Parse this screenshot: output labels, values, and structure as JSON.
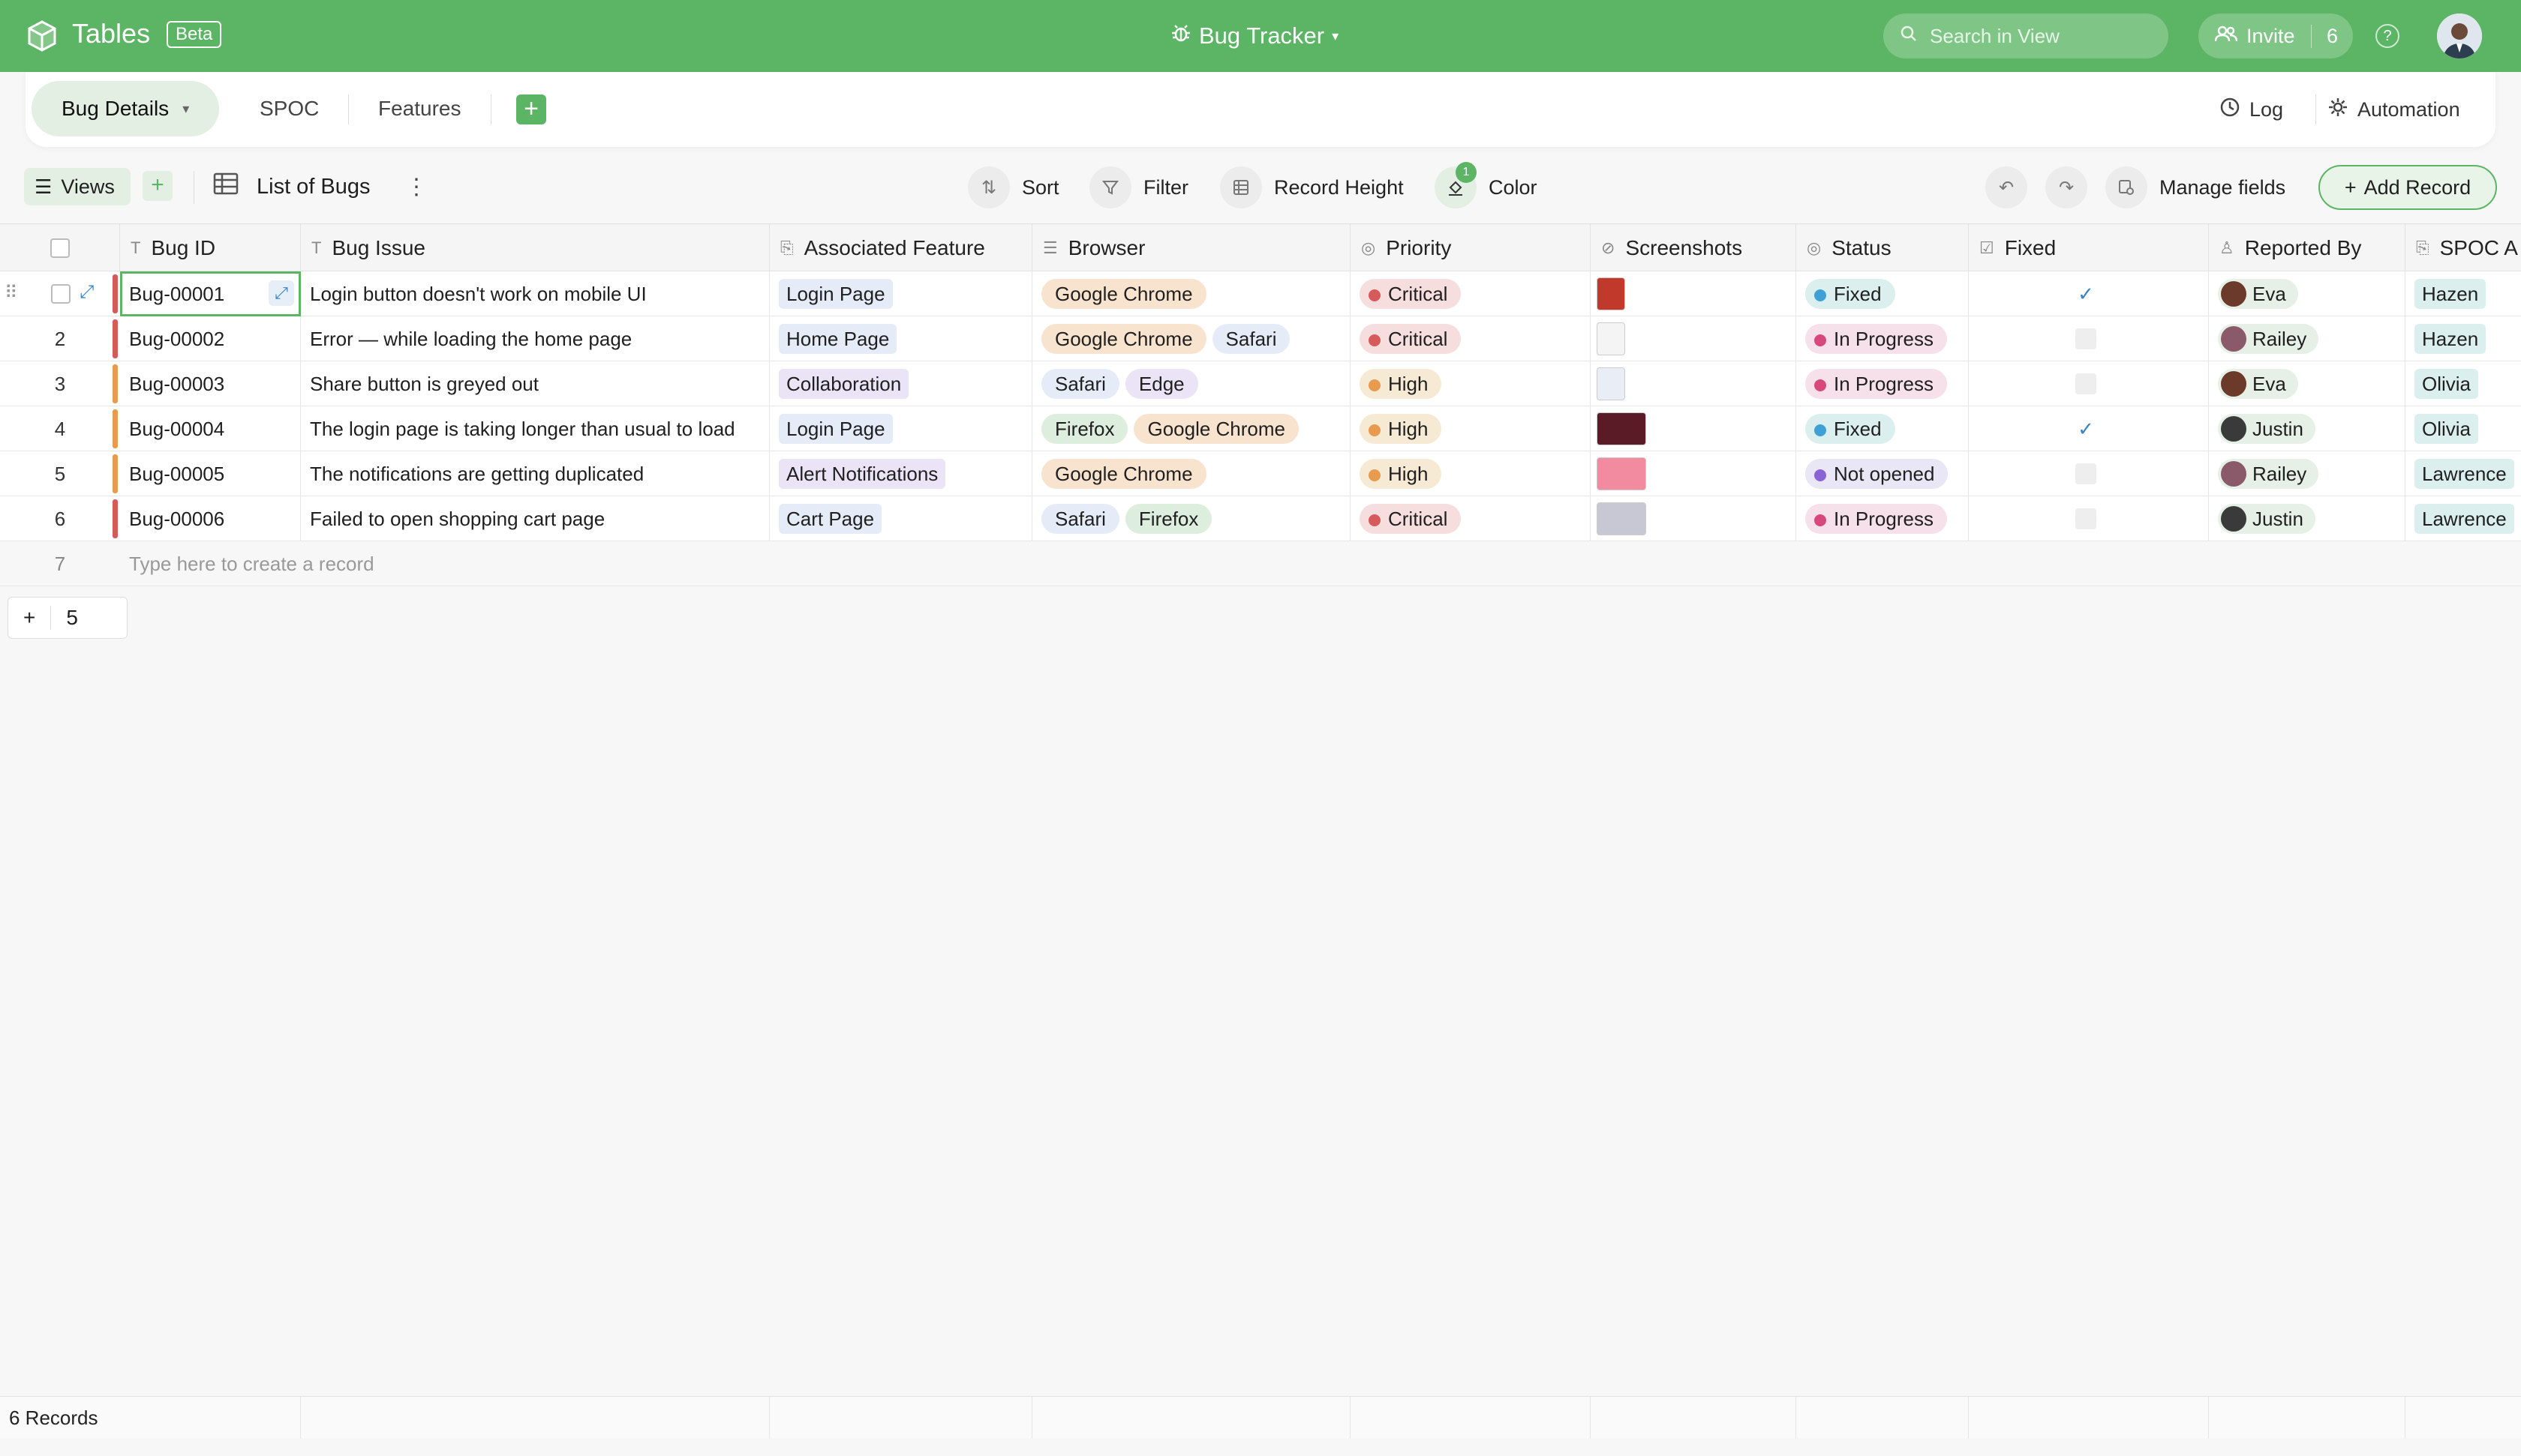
{
  "app": {
    "name": "Tables",
    "badge": "Beta",
    "base_title": "Bug Tracker"
  },
  "search": {
    "placeholder": "Search in View"
  },
  "invite": {
    "label": "Invite",
    "count": "6"
  },
  "tabs": [
    {
      "label": "Bug Details",
      "active": true
    },
    {
      "label": "SPOC"
    },
    {
      "label": "Features"
    }
  ],
  "tabbar_right": {
    "log": "Log",
    "automation": "Automation"
  },
  "toolbar": {
    "views": "Views",
    "view_name": "List of Bugs",
    "sort": "Sort",
    "filter": "Filter",
    "record_height": "Record Height",
    "color": "Color",
    "color_badge": "1",
    "manage_fields": "Manage fields",
    "add_record": "Add Record"
  },
  "columns": [
    "Bug ID",
    "Bug Issue",
    "Associated Feature",
    "Browser",
    "Priority",
    "Screenshots",
    "Status",
    "Fixed",
    "Reported By",
    "SPOC A"
  ],
  "rows": [
    {
      "num": "1",
      "id": "Bug-00001",
      "issue": "Login button doesn't work on mobile UI",
      "feature": "Login Page",
      "browsers": [
        "Google Chrome"
      ],
      "priority": "Critical",
      "status": "Fixed",
      "fixed": true,
      "reporter": "Eva",
      "spoc": "Hazen",
      "bar": "#d65a5a",
      "thumb": "#c0392b"
    },
    {
      "num": "2",
      "id": "Bug-00002",
      "issue": "Error — while loading the home page",
      "feature": "Home Page",
      "browsers": [
        "Google Chrome",
        "Safari"
      ],
      "priority": "Critical",
      "status": "In Progress",
      "fixed": false,
      "reporter": "Railey",
      "spoc": "Hazen",
      "bar": "#d65a5a",
      "thumb": "#f4f4f4"
    },
    {
      "num": "3",
      "id": "Bug-00003",
      "issue": "Share button is greyed out",
      "feature": "Collaboration",
      "browsers": [
        "Safari",
        "Edge"
      ],
      "priority": "High",
      "status": "In Progress",
      "fixed": false,
      "reporter": "Eva",
      "spoc": "Olivia",
      "bar": "#e89a4f",
      "thumb": "#e9eef6"
    },
    {
      "num": "4",
      "id": "Bug-00004",
      "issue": "The login page is taking longer than usual to load",
      "feature": "Login Page",
      "browsers": [
        "Firefox",
        "Google Chrome"
      ],
      "priority": "High",
      "status": "Fixed",
      "fixed": true,
      "reporter": "Justin",
      "spoc": "Olivia",
      "bar": "#e89a4f",
      "thumb": "#5a1a26"
    },
    {
      "num": "5",
      "id": "Bug-00005",
      "issue": "The notifications are getting duplicated",
      "feature": "Alert Notifications",
      "browsers": [
        "Google Chrome"
      ],
      "priority": "High",
      "status": "Not opened",
      "fixed": false,
      "reporter": "Railey",
      "spoc": "Lawrence",
      "bar": "#e89a4f",
      "thumb": "#f28aa0"
    },
    {
      "num": "6",
      "id": "Bug-00006",
      "issue": "Failed to open shopping cart page",
      "feature": "Cart Page",
      "browsers": [
        "Safari",
        "Firefox"
      ],
      "priority": "Critical",
      "status": "In Progress",
      "fixed": false,
      "reporter": "Justin",
      "spoc": "Lawrence",
      "bar": "#d65a5a",
      "thumb": "#c8c8d4"
    }
  ],
  "new_row": {
    "num": "7",
    "placeholder": "Type here to create a record"
  },
  "pager": {
    "plus": "+",
    "value": "5"
  },
  "footer": {
    "records": "6 Records"
  },
  "colors": {
    "accent": "#5cb565",
    "critical": "#d65a5a",
    "high": "#e89a4f",
    "fixed": "#3fa0d6",
    "in_progress": "#d9487a",
    "not_opened": "#8a64d6"
  }
}
